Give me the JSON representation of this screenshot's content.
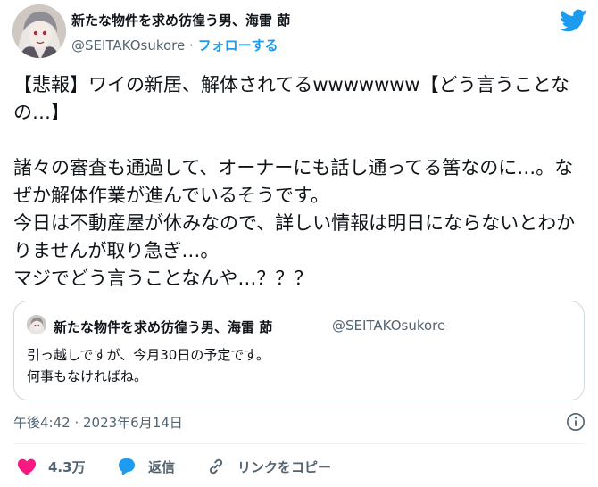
{
  "header": {
    "display_name": "新たな物件を求め彷徨う男、海雷 莭",
    "handle": "@SEITAKOsukore",
    "separator": "·",
    "follow_label": "フォローする"
  },
  "tweet": {
    "text": "【悲報】ワイの新居、解体されてるwwwwwww【どう言うことなの…】\n\n諸々の審査も通過して、オーナーにも話し通ってる筈なのに…。なぜか解体作業が進んでいるそうです。\n今日は不動産屋が休みなので、詳しい情報は明日にならないとわかりませんが取り急ぎ…。\nマジでどう言うことなんや…？？？"
  },
  "quote": {
    "display_name": "新たな物件を求め彷徨う男、海雷 莭",
    "handle": "@SEITAKOsukore",
    "text": "引っ越しですが、今月30日の予定です。\n何事もなければね。"
  },
  "meta": {
    "timestamp": "午後4:42 · 2023年6月14日"
  },
  "actions": {
    "like_count": "4.3万",
    "reply_label": "返信",
    "copy_link_label": "リンクをコピー"
  },
  "colors": {
    "brand": "#1d9bf0",
    "like": "#f91880",
    "text_primary": "#0f1419",
    "text_secondary": "#536471"
  },
  "icons": [
    "avatar-image",
    "twitter-bird-icon",
    "info-icon",
    "heart-icon",
    "reply-bubble-icon",
    "link-icon"
  ]
}
